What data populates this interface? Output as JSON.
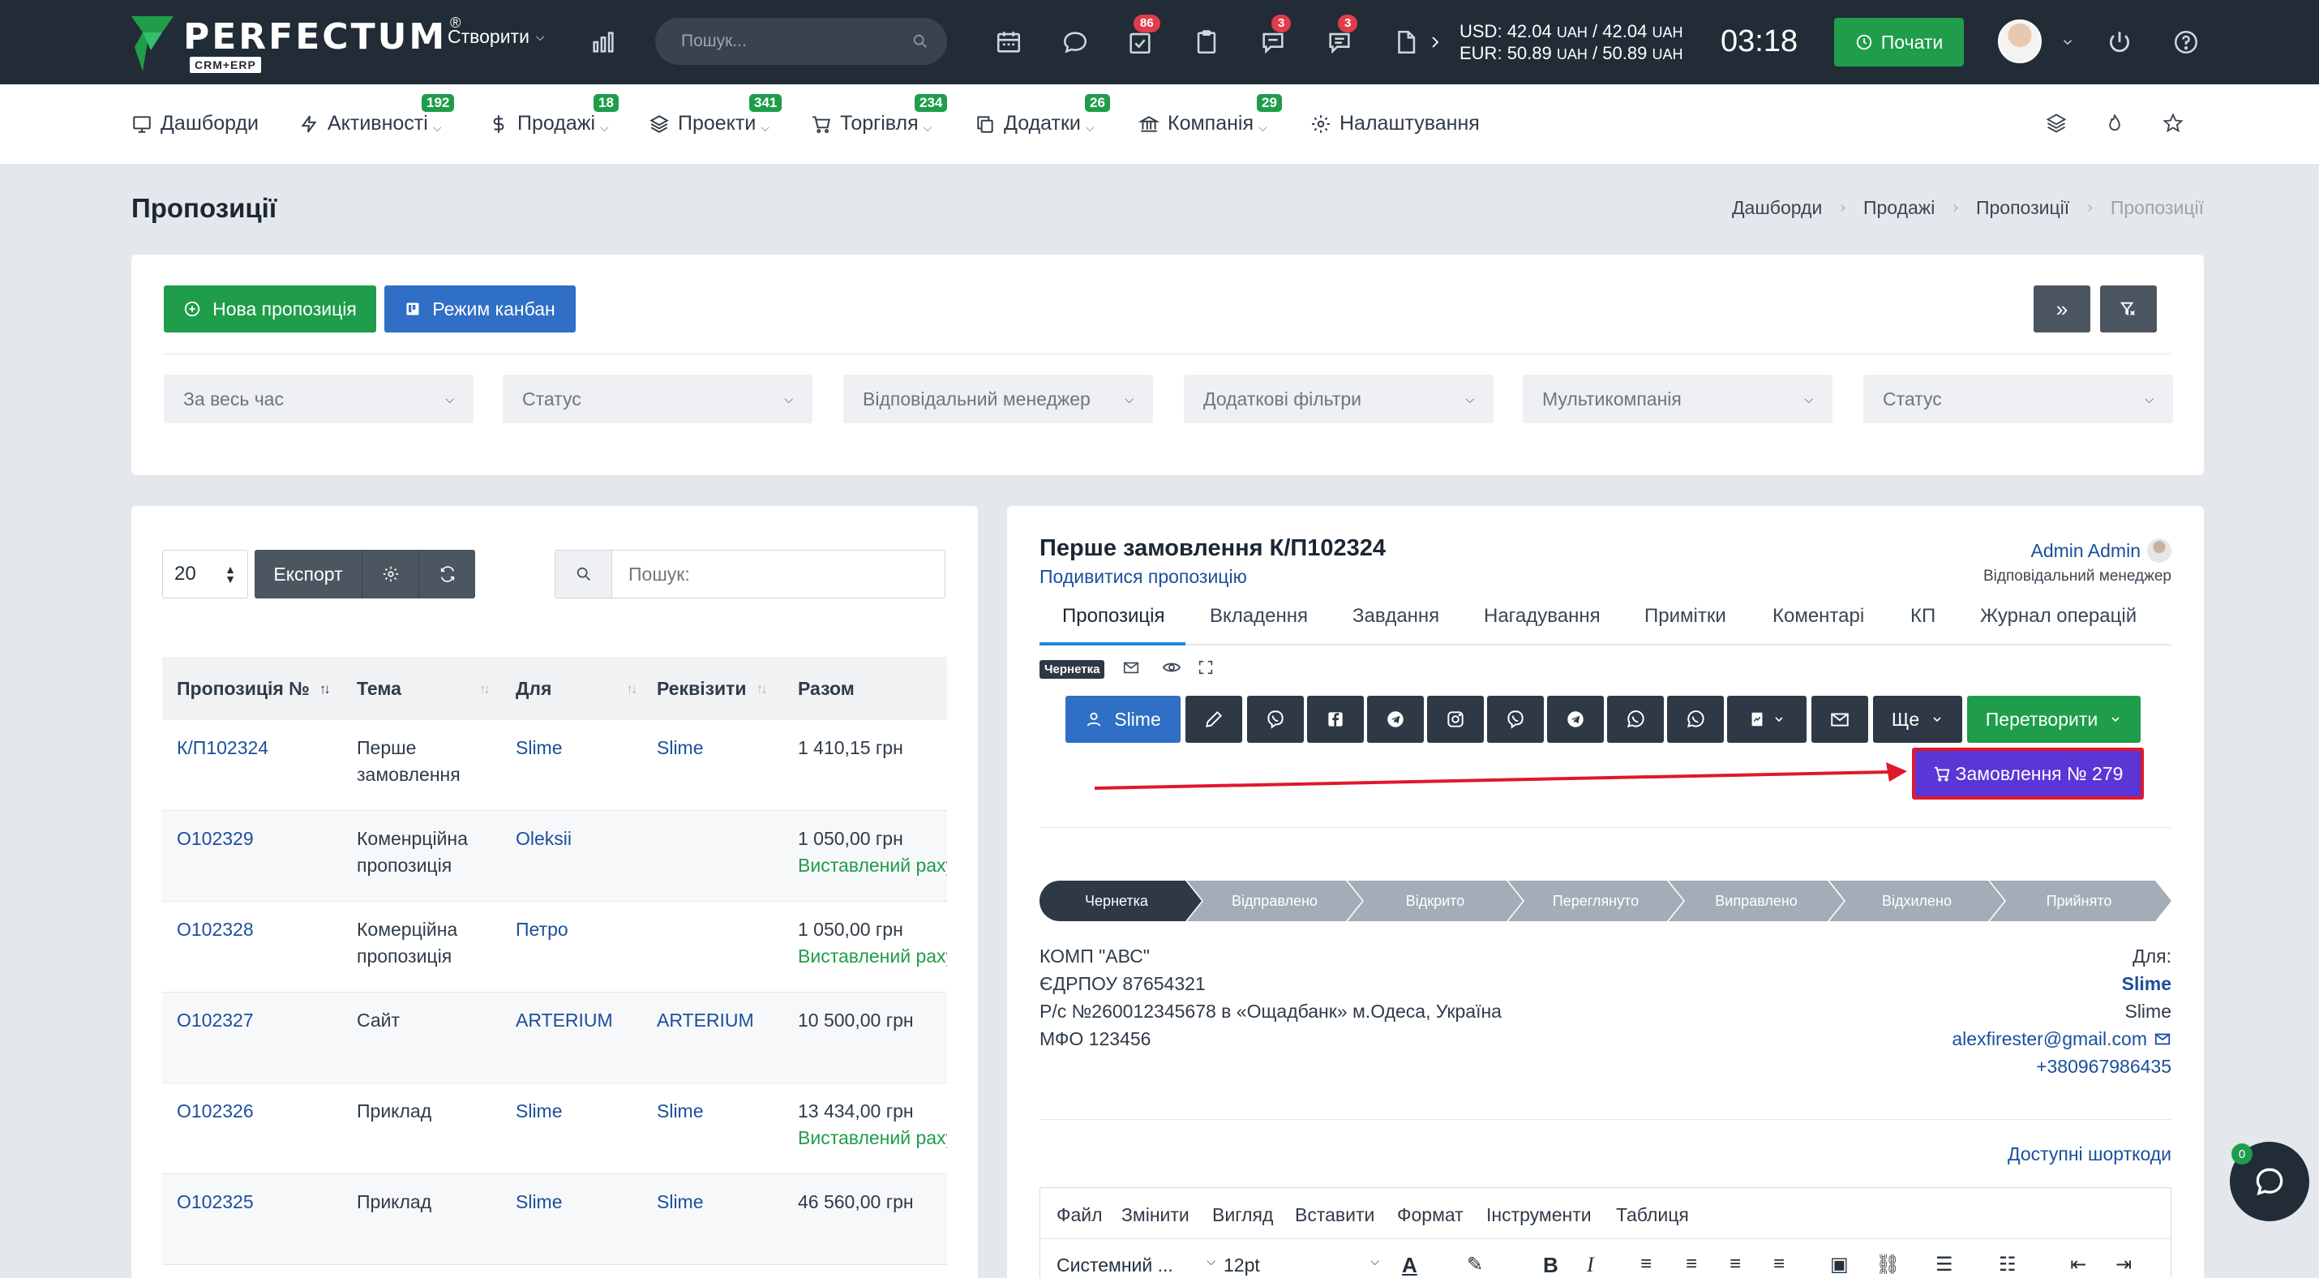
{
  "app": {
    "brand": "PERFECTUM",
    "brand_reg": "®",
    "brand_sub": "CRM+ERP"
  },
  "topbar": {
    "create_label": "Створити",
    "search_placeholder": "Пошук...",
    "badges": {
      "tasks": "86",
      "chat": "3",
      "messages": "3"
    },
    "rates": {
      "usd_label": "USD:",
      "usd_value": "42.04",
      "usd_value2": "42.04",
      "eur_label": "EUR:",
      "eur_value": "50.89",
      "eur_value2": "50.89",
      "currency": "UAH",
      "sep": "/"
    },
    "clock": "03:18",
    "start_label": "Почати"
  },
  "nav": {
    "items": [
      {
        "label": "Дашборди",
        "icon": "dashboard-icon",
        "badge": ""
      },
      {
        "label": "Активності",
        "icon": "bolt-icon",
        "badge": "192"
      },
      {
        "label": "Продажі",
        "icon": "dollar-icon",
        "badge": "18"
      },
      {
        "label": "Проекти",
        "icon": "layers-icon",
        "badge": "341"
      },
      {
        "label": "Торгівля",
        "icon": "cart-icon",
        "badge": "234"
      },
      {
        "label": "Додатки",
        "icon": "copy-icon",
        "badge": "26"
      },
      {
        "label": "Компанія",
        "icon": "bank-icon",
        "badge": "29"
      },
      {
        "label": "Налаштування",
        "icon": "gear-icon",
        "badge": ""
      }
    ]
  },
  "page": {
    "title": "Пропозиції",
    "breadcrumb": [
      "Дашборди",
      "Продажі",
      "Пропозиції",
      "Пропозиції"
    ]
  },
  "filters": {
    "new_proposal": "Нова пропозиція",
    "kanban": "Режим канбан",
    "selects": [
      "За весь час",
      "Статус",
      "Відповідальний менеджер",
      "Додаткові фільтри",
      "Мультикомпанія",
      "Статус"
    ]
  },
  "list": {
    "per_page": "20",
    "export": "Експорт",
    "search_placeholder": "Пошук:",
    "columns": [
      "Пропозиція №",
      "Тема",
      "Для",
      "Реквізити",
      "Разом"
    ],
    "rows": [
      {
        "number": "К/П102324",
        "subject": "Перше замовлення",
        "for": "Slime",
        "req": "Slime",
        "total": "1 410,15 грн",
        "status": ""
      },
      {
        "number": "О102329",
        "subject": "Коменрційна пропозиція",
        "for": "Oleksii",
        "req": "",
        "total": "1 050,00 грн",
        "status": "Виставлений рахунок"
      },
      {
        "number": "О102328",
        "subject": "Комерційна пропозиція",
        "for": "Петро",
        "req": "",
        "total": "1 050,00 грн",
        "status": "Виставлений рахунок"
      },
      {
        "number": "О102327",
        "subject": "Сайт",
        "for": "ARTERIUM",
        "req": "ARTERIUM",
        "total": "10 500,00 грн",
        "status": ""
      },
      {
        "number": "О102326",
        "subject": "Приклад",
        "for": "Slime",
        "req": "Slime",
        "total": "13 434,00 грн",
        "status": "Виставлений рахунок"
      },
      {
        "number": "О102325",
        "subject": "Приклад",
        "for": "Slime",
        "req": "Slime",
        "total": "46 560,00 грн",
        "status": ""
      }
    ]
  },
  "detail": {
    "title": "Перше замовлення К/П102324",
    "view_link": "Подивитися пропозицію",
    "manager_name": "Admin Admin",
    "manager_role": "Відповідальний менеджер",
    "tabs": [
      "Пропозиція",
      "Вкладення",
      "Завдання",
      "Нагадування",
      "Примітки",
      "Коментарі",
      "КП",
      "Журнал операцій"
    ],
    "status_badge": "Чернетка",
    "client_button": "Slime",
    "more_button": "Ще",
    "convert_button": "Перетворити",
    "order_button": "Замовлення № 279",
    "pipeline": [
      "Чернетка",
      "Відправлено",
      "Відкрито",
      "Переглянуто",
      "Виправлено",
      "Відхилено",
      "Прийнято"
    ],
    "company": [
      "КОМП \"АВС\"",
      "ЄДРПОУ 87654321",
      "Р/с №260012345678 в «Ощадбанк» м.Одеса, Україна",
      "МФО 123456"
    ],
    "to_label": "Для:",
    "to_name": "Slime",
    "to_name2": "Slime",
    "to_email": "alexfirester@gmail.com",
    "to_phone": "+380967986435",
    "shortcodes": "Доступні шорткоди",
    "editor_menu": [
      "Файл",
      "Змінити",
      "Вигляд",
      "Вставити",
      "Формат",
      "Інструменти",
      "Таблиця"
    ],
    "font_select": "Системний ...",
    "size_select": "12pt"
  },
  "chat": {
    "count": "0"
  },
  "colors": {
    "green": "#1f9d4a",
    "blue": "#2f6fc5",
    "dark": "#212c37",
    "red": "#e0182b",
    "purple": "#5a36d6"
  }
}
